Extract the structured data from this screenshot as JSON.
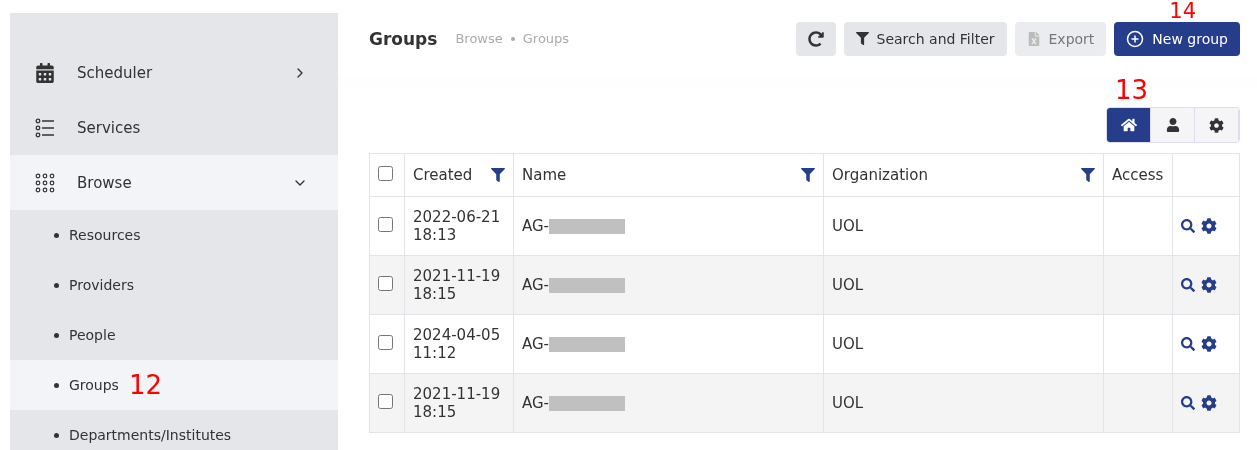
{
  "sidebar": {
    "items": [
      {
        "label": "Scheduler",
        "kind": "group",
        "expanded": false,
        "selected": false
      },
      {
        "label": "Services",
        "kind": "link",
        "selected": false
      },
      {
        "label": "Browse",
        "kind": "group",
        "expanded": true,
        "selected": true,
        "children": [
          {
            "label": "Resources",
            "selected": false
          },
          {
            "label": "Providers",
            "selected": false
          },
          {
            "label": "People",
            "selected": false
          },
          {
            "label": "Groups",
            "selected": true,
            "callout": "12"
          },
          {
            "label": "Departments/Institutes",
            "selected": false
          }
        ]
      }
    ]
  },
  "header": {
    "title": "Groups",
    "breadcrumb": [
      "Browse",
      "Groups"
    ],
    "buttons": [
      {
        "kind": "refresh",
        "disabled": false
      },
      {
        "kind": "filter",
        "label": "Search and Filter",
        "disabled": false
      },
      {
        "kind": "export",
        "label": "Export",
        "disabled": true
      },
      {
        "kind": "primary",
        "label": "New group",
        "disabled": false,
        "callout": "14"
      }
    ]
  },
  "view_toggle": {
    "callout": "13",
    "options": [
      {
        "selected": true
      },
      {
        "selected": false
      },
      {
        "selected": false
      }
    ]
  },
  "table": {
    "select_all": {
      "checked": false
    },
    "columns": [
      {
        "label": "Created",
        "filter": true
      },
      {
        "label": "Name",
        "filter": true
      },
      {
        "label": "Organization",
        "filter": true
      },
      {
        "label": "Access",
        "filter": false
      }
    ],
    "rows": [
      {
        "checked": false,
        "date": "2022-06-21",
        "time": "18:13",
        "name": "AG-",
        "redacted": true,
        "organization": "UOL"
      },
      {
        "checked": false,
        "date": "2021-11-19",
        "time": "18:15",
        "name": "AG-",
        "redacted": true,
        "organization": "UOL"
      },
      {
        "checked": false,
        "date": "2024-04-05",
        "time": "11:12",
        "name": "AG-",
        "redacted": true,
        "organization": "UOL"
      },
      {
        "checked": false,
        "date": "2021-11-19",
        "time": "18:15",
        "name": "AG-",
        "redacted": true,
        "organization": "UOL"
      }
    ]
  }
}
